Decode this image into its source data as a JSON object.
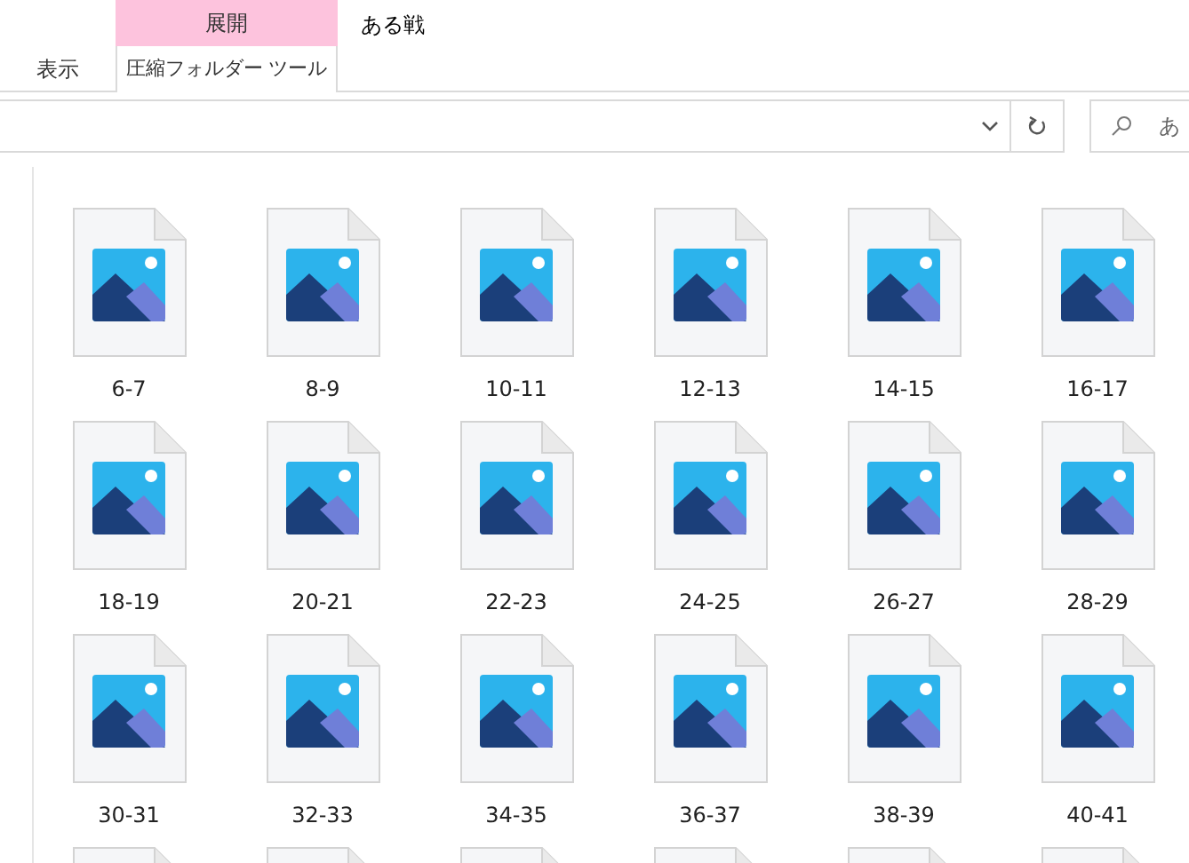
{
  "ribbon": {
    "context_group": "展開",
    "window_title": "ある戦",
    "tabs": [
      {
        "label": "表示",
        "selected": false
      },
      {
        "label": "圧縮フォルダー ツール",
        "selected": true
      }
    ]
  },
  "search": {
    "placeholder": "あ"
  },
  "files": [
    {
      "name": "6-7"
    },
    {
      "name": "8-9"
    },
    {
      "name": "10-11"
    },
    {
      "name": "12-13"
    },
    {
      "name": "14-15"
    },
    {
      "name": "16-17"
    },
    {
      "name": "18-19"
    },
    {
      "name": "20-21"
    },
    {
      "name": "22-23"
    },
    {
      "name": "24-25"
    },
    {
      "name": "26-27"
    },
    {
      "name": "28-29"
    },
    {
      "name": "30-31"
    },
    {
      "name": "32-33"
    },
    {
      "name": "34-35"
    },
    {
      "name": "36-37"
    },
    {
      "name": "38-39"
    },
    {
      "name": "40-41"
    },
    {
      "kind": "cut"
    },
    {
      "kind": "cut"
    },
    {
      "kind": "cut"
    },
    {
      "kind": "cut"
    },
    {
      "kind": "cut"
    },
    {
      "kind": "cut"
    }
  ]
}
